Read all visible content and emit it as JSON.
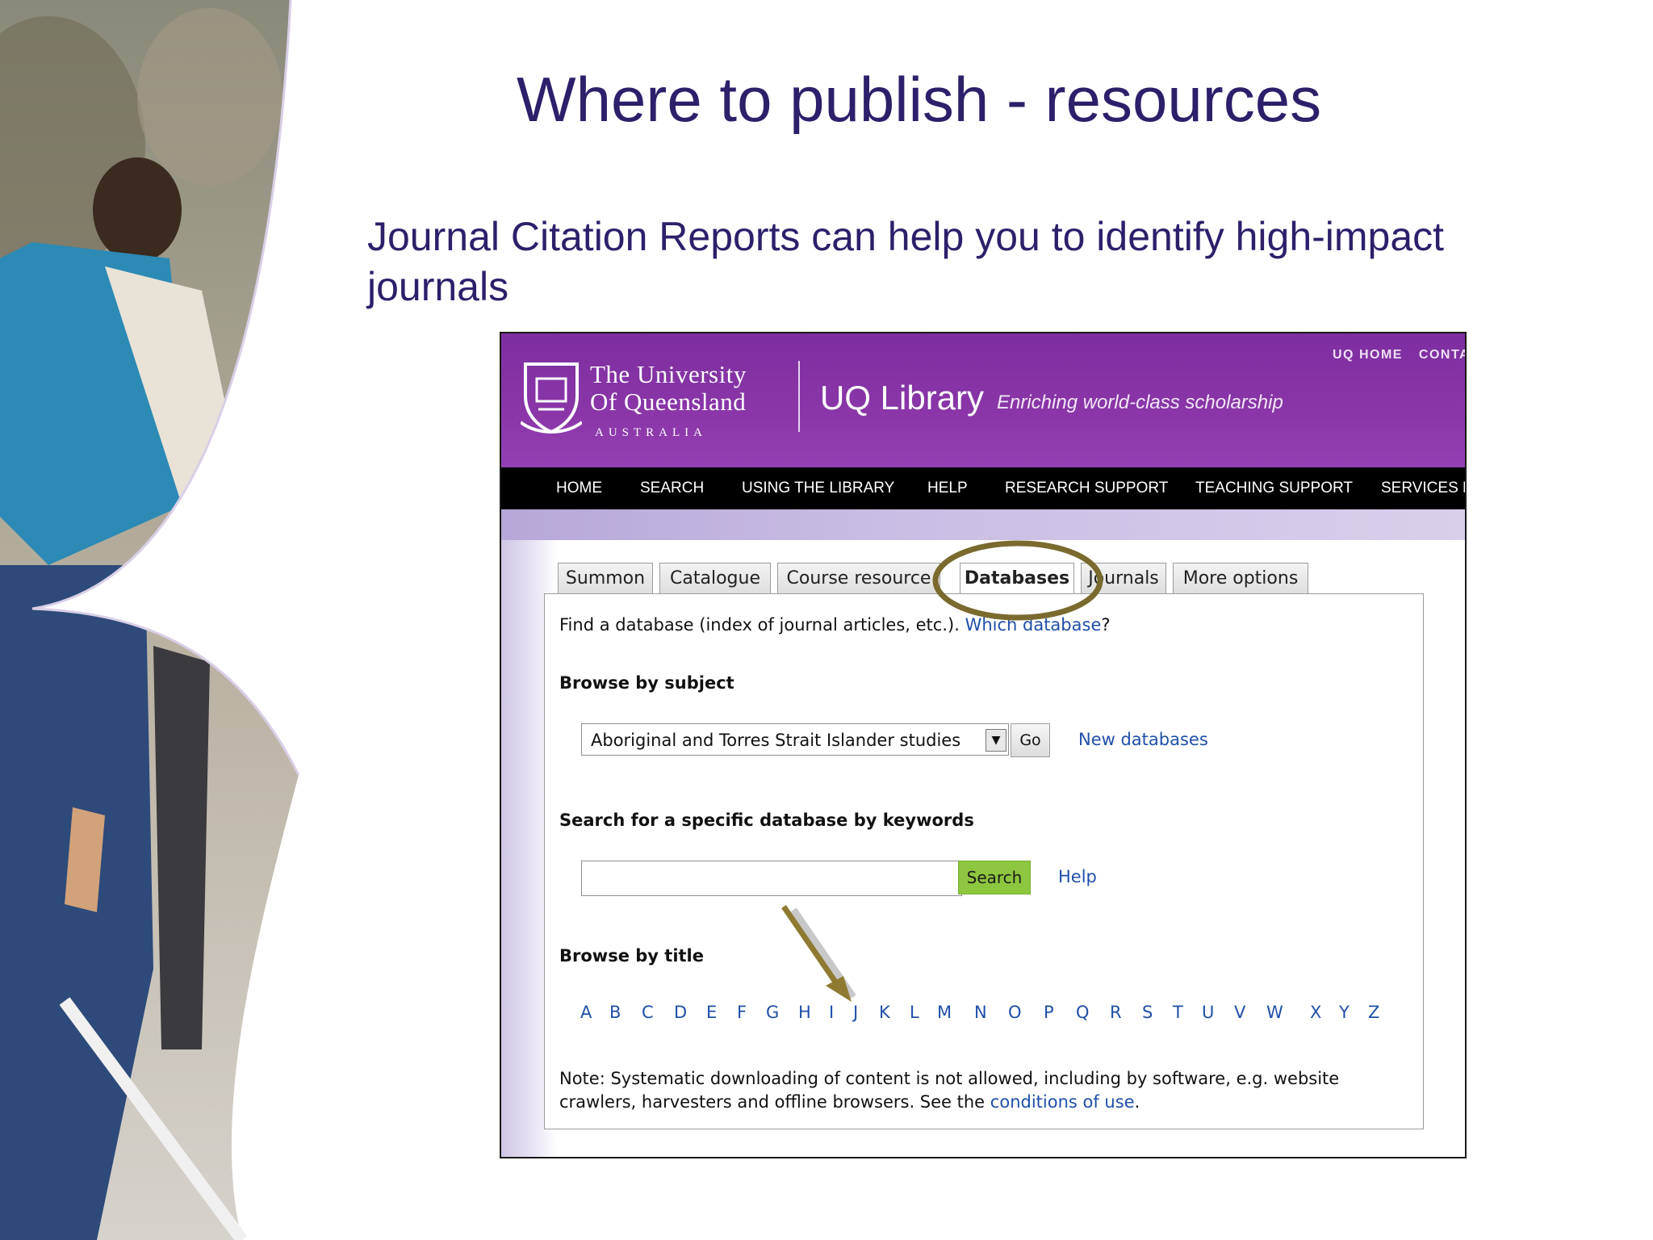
{
  "slide": {
    "title": "Where to publish - resources",
    "body": "Journal Citation Reports can help you to identify high-impact journals"
  },
  "uq": {
    "university_line1": "The University",
    "university_line2": "Of Queensland",
    "university_line3": "AUSTRALIA",
    "library_title": "UQ Library",
    "tagline": "Enriching world-class scholarship",
    "util_links": [
      "UQ HOME",
      "CONTA"
    ],
    "nav": [
      "HOME",
      "SEARCH",
      "USING THE LIBRARY",
      "HELP",
      "RESEARCH SUPPORT",
      "TEACHING SUPPORT",
      "SERVICES F"
    ],
    "tabs": [
      "Summon",
      "Catalogue",
      "Course resource",
      "Databases",
      "Journals",
      "More options"
    ],
    "active_tab": "Databases",
    "intro_text": "Find a database (index of journal articles, etc.).",
    "which_db_link": "Which database",
    "intro_suffix": "?",
    "browse_subject_heading": "Browse by subject",
    "subject_select_value": "Aboriginal and Torres Strait Islander studies",
    "go_label": "Go",
    "new_databases_link": "New databases",
    "keyword_heading": "Search for a specific database by keywords",
    "keyword_input_value": "",
    "search_label": "Search",
    "help_link": "Help",
    "browse_title_heading": "Browse by title",
    "letters": [
      "A",
      "B",
      "C",
      "D",
      "E",
      "F",
      "G",
      "H",
      "I",
      "J",
      "K",
      "L",
      "M",
      "N",
      "O",
      "P",
      "Q",
      "R",
      "S",
      "T",
      "U",
      "V",
      "W",
      "X",
      "Y",
      "Z"
    ],
    "note_prefix": "Note: Systematic downloading of content is not allowed, including by software, e.g. website crawlers, harvesters and offline browsers. See the",
    "conditions_link": "conditions of use",
    "note_suffix": "."
  },
  "colors": {
    "title": "#2e1f6b",
    "header_purple": "#8a36a8",
    "link": "#1f4fa8",
    "search_green": "#8dc63f",
    "annotation_olive": "#7a6a2e"
  }
}
